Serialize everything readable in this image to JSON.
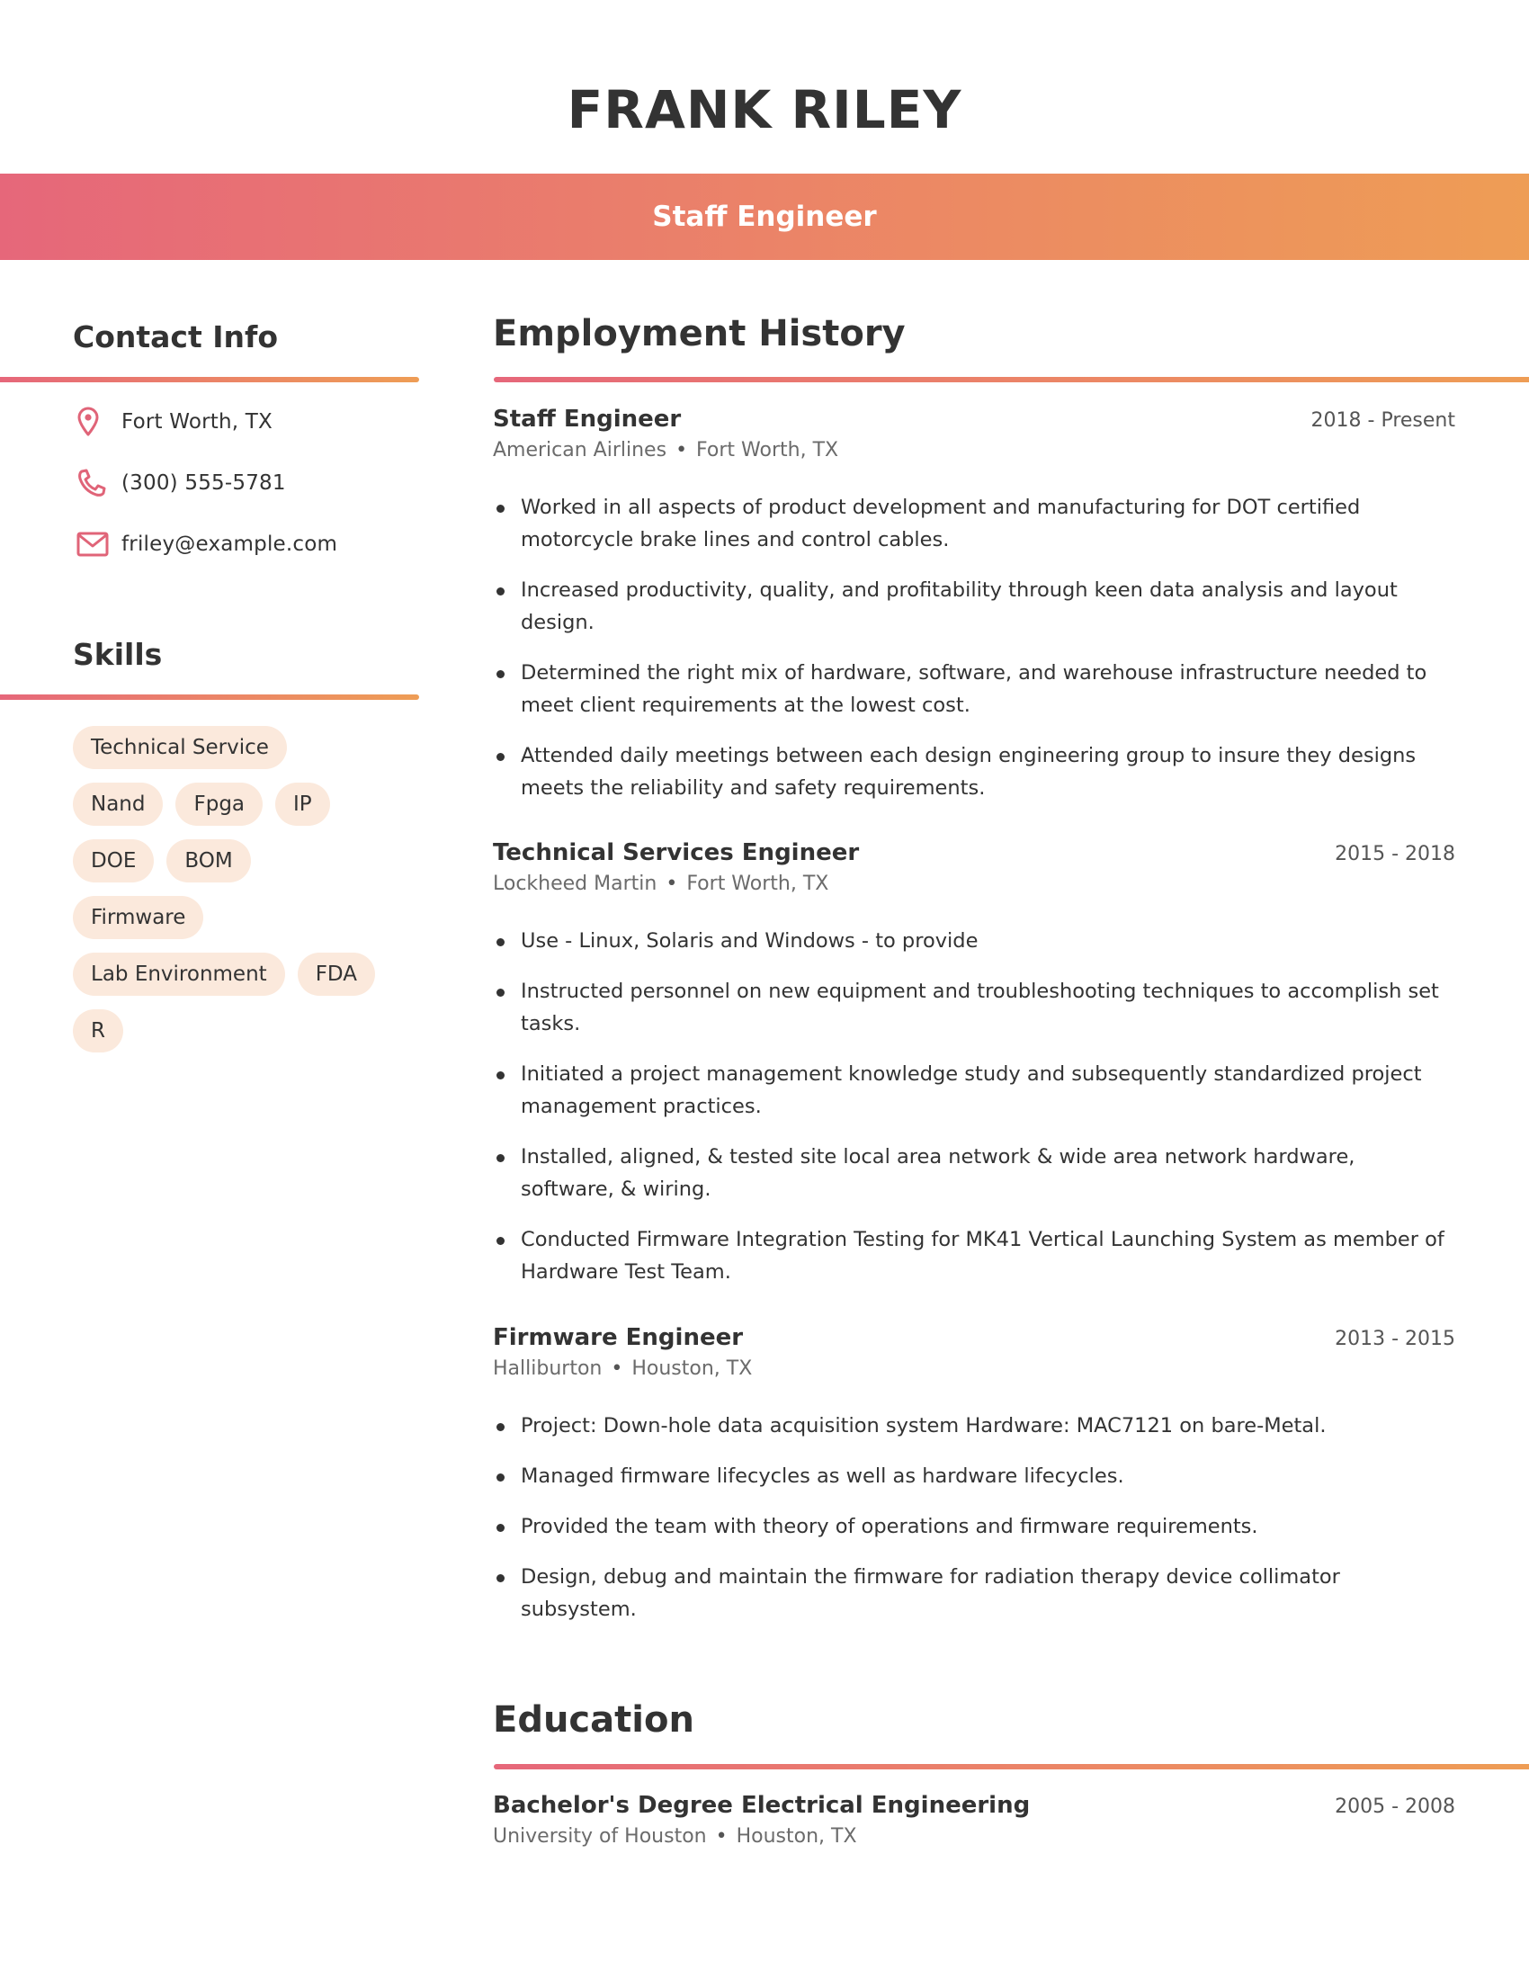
{
  "header": {
    "name": "FRANK RILEY",
    "title": "Staff Engineer"
  },
  "colors": {
    "gradient_start": "#e6677a",
    "gradient_end": "#ee9d55",
    "tag_background": "#fbe9dc",
    "icon_color": "#e06478",
    "text": "#333333"
  },
  "contact": {
    "heading": "Contact Info",
    "items": [
      {
        "icon": "location-pin-icon",
        "text": "Fort Worth, TX"
      },
      {
        "icon": "phone-icon",
        "text": "(300) 555-5781"
      },
      {
        "icon": "envelope-icon",
        "text": "friley@example.com"
      }
    ]
  },
  "skills": {
    "heading": "Skills",
    "rows": [
      [
        "Technical Service"
      ],
      [
        "Nand",
        "Fpga",
        "IP"
      ],
      [
        "DOE",
        "BOM"
      ],
      [
        "Firmware"
      ],
      [
        "Lab Environment",
        "FDA"
      ],
      [
        "R"
      ]
    ]
  },
  "employment": {
    "heading": "Employment History",
    "jobs": [
      {
        "title": "Staff Engineer",
        "dates": "2018 - Present",
        "company": "American Airlines",
        "location": "Fort Worth, TX",
        "bullets": [
          "Worked in all aspects of product development and manufacturing for DOT certified motorcycle brake lines and control cables.",
          "Increased productivity, quality, and profitability through keen data analysis and layout design.",
          "Determined the right mix of hardware, software, and warehouse infrastructure needed to meet client requirements at the lowest cost.",
          "Attended daily meetings between each design engineering group to insure they designs meets the reliability and safety requirements."
        ]
      },
      {
        "title": "Technical Services Engineer",
        "dates": "2015 - 2018",
        "company": "Lockheed Martin",
        "location": "Fort Worth, TX",
        "bullets": [
          "Use - Linux, Solaris and Windows - to provide",
          "Instructed personnel on new equipment and troubleshooting techniques to accomplish set tasks.",
          "Initiated a project management knowledge study and subsequently standardized project management practices.",
          "Installed, aligned, & tested site local area network & wide area network hardware, software, & wiring.",
          "Conducted Firmware Integration Testing for MK41 Vertical Launching System as member of Hardware Test Team."
        ]
      },
      {
        "title": "Firmware Engineer",
        "dates": "2013 - 2015",
        "company": "Halliburton",
        "location": "Houston, TX",
        "bullets": [
          "Project: Down-hole data acquisition system Hardware: MAC7121 on bare-Metal.",
          "Managed firmware lifecycles as well as hardware lifecycles.",
          "Provided the team with theory of operations and firmware requirements.",
          "Design, debug and maintain the firmware for radiation therapy device collimator subsystem."
        ]
      }
    ]
  },
  "education": {
    "heading": "Education",
    "entries": [
      {
        "degree": "Bachelor's Degree Electrical Engineering",
        "dates": "2005 - 2008",
        "school": "University of Houston",
        "location": "Houston, TX"
      }
    ]
  }
}
